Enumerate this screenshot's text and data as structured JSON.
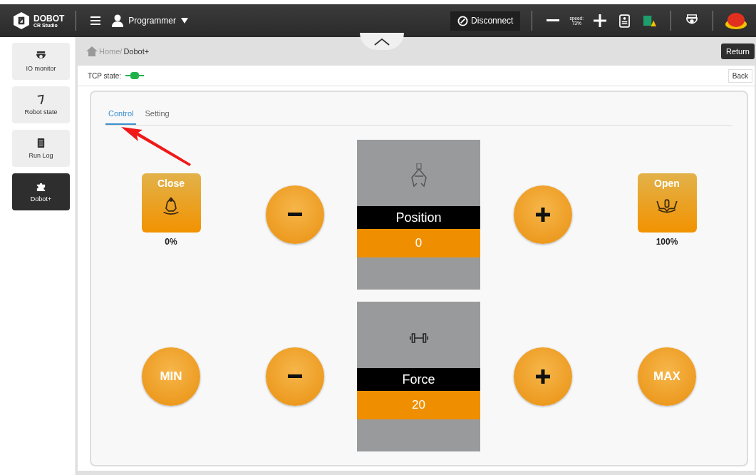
{
  "header": {
    "brand": "DOBOT",
    "brand_sub": "CR Studio",
    "user": "Programmer",
    "disconnect": "Disconnect",
    "speed_label": "speed:",
    "speed_value": "73%"
  },
  "sidebar": {
    "items": [
      {
        "label": "IO monitor",
        "selected": false
      },
      {
        "label": "Robot state",
        "selected": false
      },
      {
        "label": "Run Log",
        "selected": false
      },
      {
        "label": "Dobot+",
        "selected": true
      }
    ]
  },
  "breadcrumb": {
    "home": "Home/",
    "current": "Dobot+"
  },
  "return_button": "Return",
  "tcp_state": {
    "label": "TCP state:",
    "connected": true
  },
  "back_button": "Back",
  "tabs": [
    {
      "label": "Control",
      "selected": true
    },
    {
      "label": "Setting",
      "selected": false
    }
  ],
  "rows": [
    {
      "left": {
        "kind": "tile",
        "label": "Close",
        "caption": "0%"
      },
      "label": "Position",
      "value": "0",
      "right": {
        "kind": "tile",
        "label": "Open",
        "caption": "100%"
      }
    },
    {
      "left": {
        "kind": "circle",
        "label": "MIN"
      },
      "label": "Force",
      "value": "20",
      "right": {
        "kind": "circle",
        "label": "MAX"
      }
    }
  ]
}
